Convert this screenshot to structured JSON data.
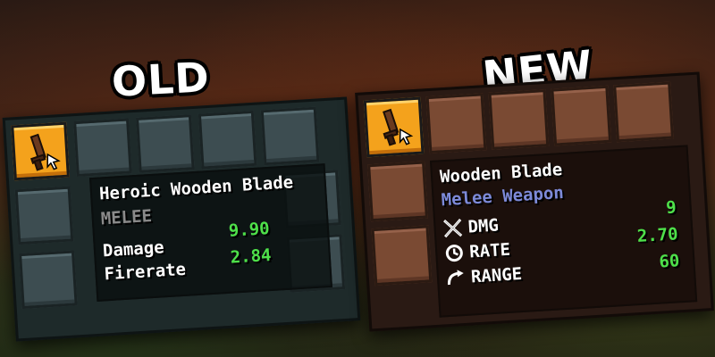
{
  "headings": {
    "old": "OLD",
    "new": "NEW"
  },
  "old_tooltip": {
    "title": "Heroic Wooden Blade",
    "type": "MELEE",
    "stats": [
      {
        "name": "Damage",
        "value": "9.90"
      },
      {
        "name": "Firerate",
        "value": "2.84"
      }
    ]
  },
  "new_tooltip": {
    "title": "Wooden Blade",
    "type": "Melee Weapon",
    "stats": [
      {
        "name": "DMG",
        "value": "9",
        "icon": "crossed-swords-icon"
      },
      {
        "name": "RATE",
        "value": "2.70",
        "icon": "clock-icon"
      },
      {
        "name": "RANGE",
        "value": "60",
        "icon": "range-arc-icon"
      }
    ]
  },
  "colors": {
    "stat_value": "#4ee04a",
    "weapon_type_new": "#7d8ad9",
    "weapon_type_old": "#8a8a8a",
    "icon_slot": "#f4a21c"
  },
  "item_icon": "wooden-sword-icon"
}
